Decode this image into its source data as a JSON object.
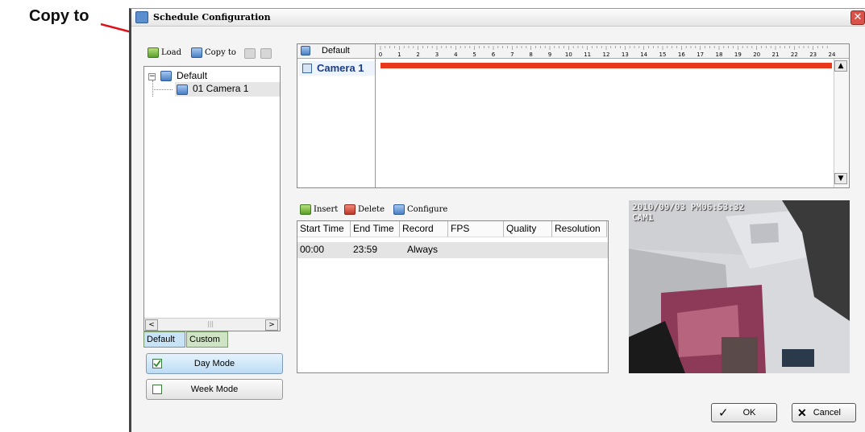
{
  "annotation": {
    "label": "Copy to"
  },
  "window": {
    "title": "Schedule Configuration"
  },
  "toolbar": {
    "load_label": "Load",
    "copy_to_label": "Copy to"
  },
  "tree": {
    "root_label": "Default",
    "child_label": "01 Camera 1"
  },
  "tabs": [
    {
      "label": "Default"
    },
    {
      "label": "Custom"
    }
  ],
  "modes": {
    "day_label": "Day Mode",
    "week_label": "Week Mode"
  },
  "timeline": {
    "header_label": "Default",
    "row_label": "Camera 1",
    "hours": [
      "0",
      "1",
      "2",
      "3",
      "4",
      "5",
      "6",
      "7",
      "8",
      "9",
      "10",
      "11",
      "12",
      "13",
      "14",
      "15",
      "16",
      "17",
      "18",
      "19",
      "20",
      "21",
      "22",
      "23",
      "24"
    ],
    "bar_color": "#e8391c",
    "bar_start_hour": 0,
    "bar_end_hour": 24
  },
  "actions": {
    "insert_label": "Insert",
    "delete_label": "Delete",
    "configure_label": "Configure"
  },
  "table": {
    "columns": [
      "Start Time",
      "End Time",
      "Record",
      "FPS",
      "Quality",
      "Resolution"
    ],
    "rows": [
      {
        "start": "00:00",
        "end": "23:59",
        "record": "Always",
        "fps": "",
        "quality": "",
        "resolution": ""
      }
    ]
  },
  "preview": {
    "osd_date": "2010/09/03 PM06:53:32",
    "osd_cam": "CAM1"
  },
  "footer": {
    "ok_label": "OK",
    "cancel_label": "Cancel"
  },
  "colors": {
    "accent": "#e8391c",
    "selected_mode": "#cfe6f8",
    "tab_active": "#c9e3f6",
    "tab_inactive": "#cfe4c4"
  }
}
